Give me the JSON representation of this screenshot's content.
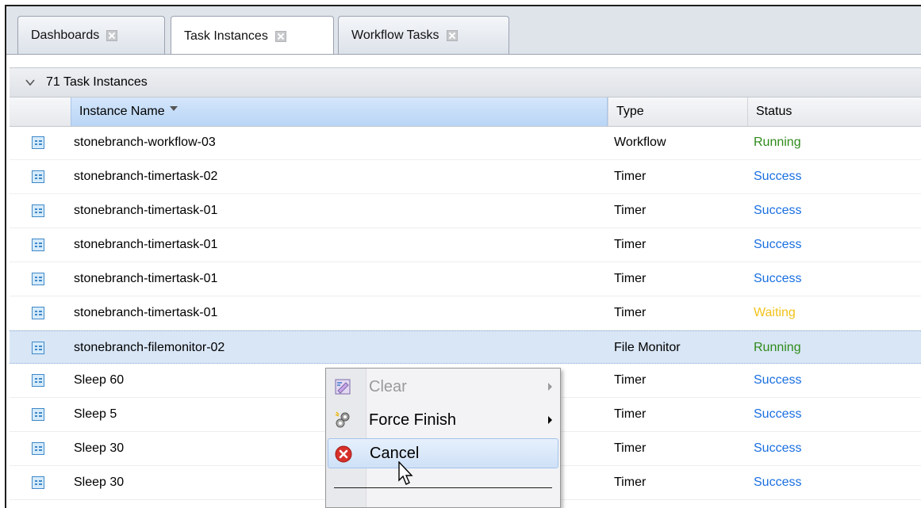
{
  "tabs": [
    {
      "label": "Dashboards",
      "active": false
    },
    {
      "label": "Task Instances",
      "active": true
    },
    {
      "label": "Workflow Tasks",
      "active": false
    }
  ],
  "group": {
    "title": "71 Task Instances"
  },
  "columns": {
    "name": "Instance Name",
    "type": "Type",
    "status": "Status"
  },
  "rows": [
    {
      "name": "stonebranch-workflow-03",
      "type": "Workflow",
      "status": "Running",
      "status_color": "#2e8b1a"
    },
    {
      "name": "stonebranch-timertask-02",
      "type": "Timer",
      "status": "Success",
      "status_color": "#1a6fe0"
    },
    {
      "name": "stonebranch-timertask-01",
      "type": "Timer",
      "status": "Success",
      "status_color": "#1a6fe0"
    },
    {
      "name": "stonebranch-timertask-01",
      "type": "Timer",
      "status": "Success",
      "status_color": "#1a6fe0"
    },
    {
      "name": "stonebranch-timertask-01",
      "type": "Timer",
      "status": "Success",
      "status_color": "#1a6fe0"
    },
    {
      "name": "stonebranch-timertask-01",
      "type": "Timer",
      "status": "Waiting",
      "status_color": "#f2c21a"
    },
    {
      "name": "stonebranch-filemonitor-02",
      "type": "File Monitor",
      "status": "Running",
      "status_color": "#2e8b1a",
      "selected": true
    },
    {
      "name": "Sleep 60",
      "type": "Timer",
      "status": "Success",
      "status_color": "#1a6fe0"
    },
    {
      "name": "Sleep 5",
      "type": "Timer",
      "status": "Success",
      "status_color": "#1a6fe0"
    },
    {
      "name": "Sleep 30",
      "type": "Timer",
      "status": "Success",
      "status_color": "#1a6fe0"
    },
    {
      "name": "Sleep 30",
      "type": "Timer",
      "status": "Success",
      "status_color": "#1a6fe0"
    }
  ],
  "context_menu": {
    "items": [
      {
        "label": "Clear",
        "icon": "clear-icon",
        "disabled": true,
        "submenu": true
      },
      {
        "label": "Force Finish",
        "icon": "force-finish-icon",
        "disabled": false,
        "submenu": true
      },
      {
        "label": "Cancel",
        "icon": "cancel-icon",
        "disabled": false,
        "submenu": false,
        "hovered": true
      }
    ]
  }
}
